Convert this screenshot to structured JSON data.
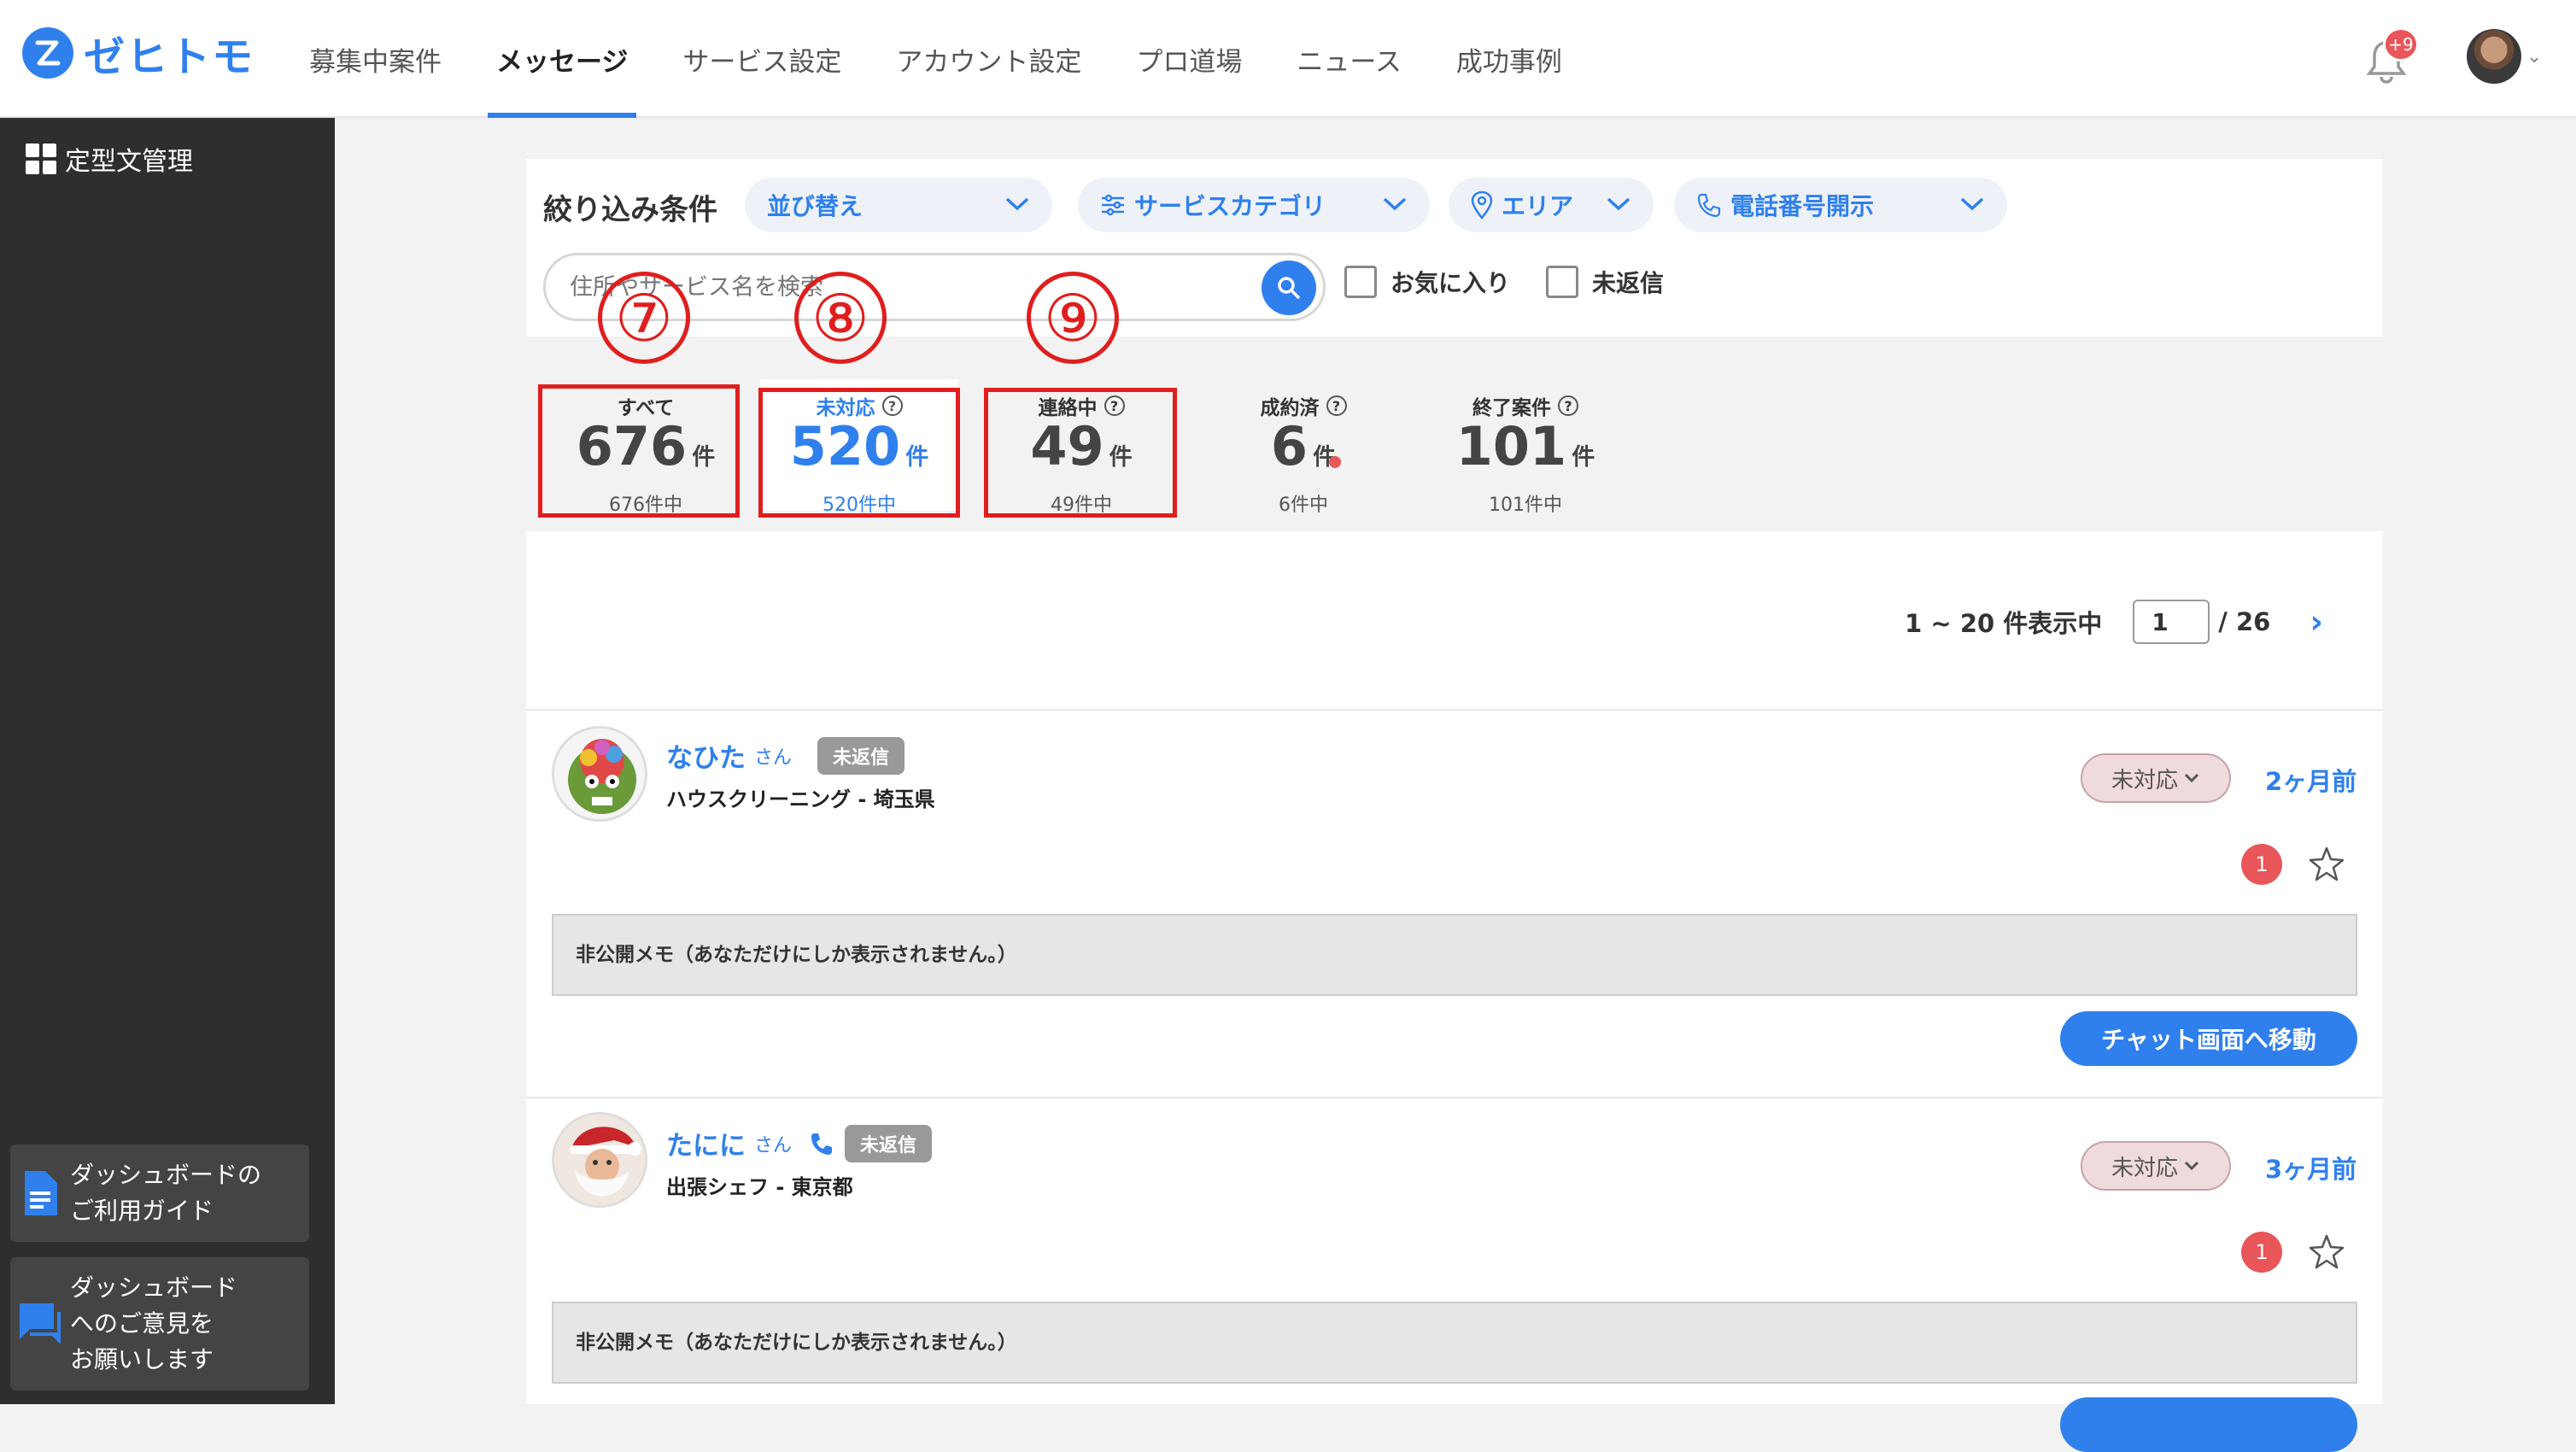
{
  "header": {
    "logo_mark": "ゼ",
    "logo_text": "ゼヒトモ",
    "nav": [
      {
        "label": "募集中案件"
      },
      {
        "label": "メッセージ"
      },
      {
        "label": "サービス設定"
      },
      {
        "label": "アカウント設定"
      },
      {
        "label": "プロ道場"
      },
      {
        "label": "ニュース"
      },
      {
        "label": "成功事例"
      }
    ],
    "notification_badge": "+9"
  },
  "sidebar": {
    "top_label": "定型文管理",
    "guide_card": "ダッシュボードのご利用ガイド",
    "guide_line1": "ダッシュボードの",
    "guide_line2": "ご利用ガイド",
    "feedback_line1": "ダッシュボード",
    "feedback_line2": "へのご意見を",
    "feedback_line3": "お願いします"
  },
  "filter": {
    "title": "絞り込み条件",
    "sort_label": "並び替え",
    "category_label": "サービスカテゴリ",
    "area_label": "エリア",
    "phone_label": "電話番号開示",
    "search_placeholder": "住所やサービス名を検索",
    "favorite_label": "お気に入り",
    "unreplied_label": "未返信"
  },
  "tabs": [
    {
      "label": "すべて",
      "count": "676",
      "unit": "件",
      "sub": "676件中"
    },
    {
      "label": "未対応",
      "count": "520",
      "unit": "件",
      "sub": "520件中"
    },
    {
      "label": "連絡中",
      "count": "49",
      "unit": "件",
      "sub": "49件中"
    },
    {
      "label": "成約済",
      "count": "6",
      "unit": "件",
      "sub": "6件中"
    },
    {
      "label": "終了案件",
      "count": "101",
      "unit": "件",
      "sub": "101件中"
    }
  ],
  "annotations": [
    "⑦",
    "⑧",
    "⑨"
  ],
  "pager": {
    "range_text": "1 ~ 20 件表示中",
    "current_page": "1",
    "total_pages": "/ 26"
  },
  "items": [
    {
      "name": "なひた",
      "san": "さん",
      "badge": "未返信",
      "service": "ハウスクリーニング - 埼玉県",
      "status": "未対応",
      "when": "2ヶ月前",
      "unread": "1",
      "memo": "非公開メモ（あなただけにしか表示されません。）",
      "chat_button": "チャット画面へ移動"
    },
    {
      "name": "たにに",
      "san": "さん",
      "badge": "未返信",
      "service": "出張シェフ - 東京都",
      "status": "未対応",
      "when": "3ヶ月前",
      "unread": "1",
      "memo": "非公開メモ（あなただけにしか表示されません。）"
    }
  ],
  "colors": {
    "accent": "#2f80ed",
    "sidebar_bg": "#2e2e2e",
    "annotation_red": "#e01e1e",
    "badge_red": "#e8565a"
  }
}
